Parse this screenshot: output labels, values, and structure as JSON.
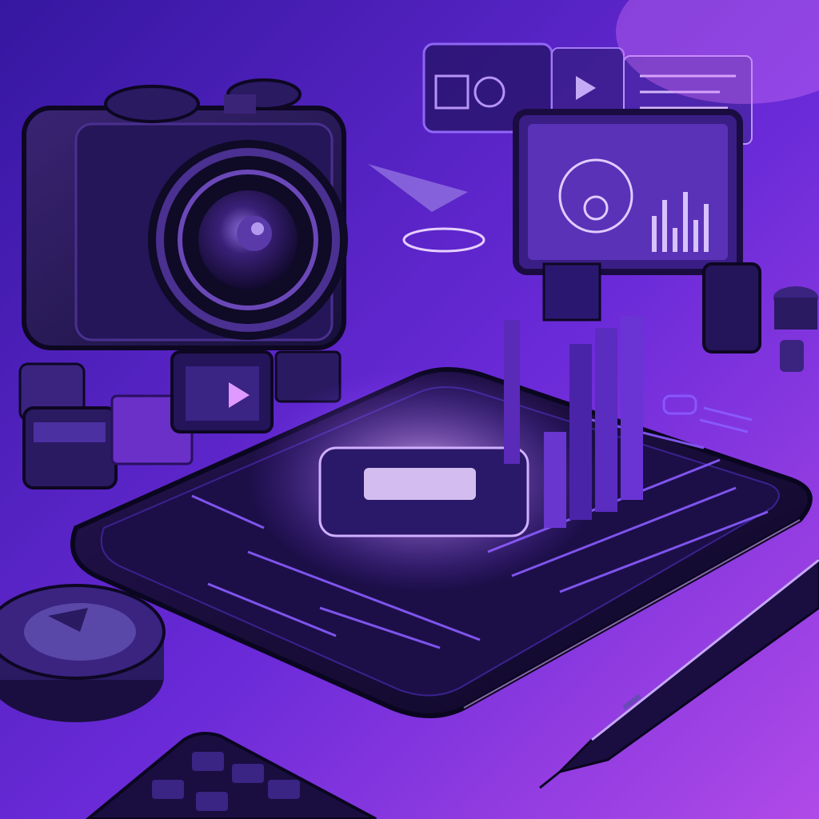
{
  "palette": {
    "background_top": "#3b1aa8",
    "background_bottom": "#b04ae8",
    "glow": "#c890ff",
    "device_body": "#120a2e",
    "screen": "#1c0f48",
    "neon_line": "#8a5cff",
    "highlight": "#e6cfff"
  },
  "objects": {
    "camera_icon": "camera-icon",
    "lens_icon": "lens-icon",
    "tablet_icon": "tablet-icon",
    "hologram_icon": "hologram-icon",
    "play_icon": "play-icon",
    "pen_icon": "pen-icon",
    "keyboard_icon": "keyboard-icon",
    "monitor_icon": "monitor-icon",
    "equalizer_icon": "equalizer-icon"
  }
}
